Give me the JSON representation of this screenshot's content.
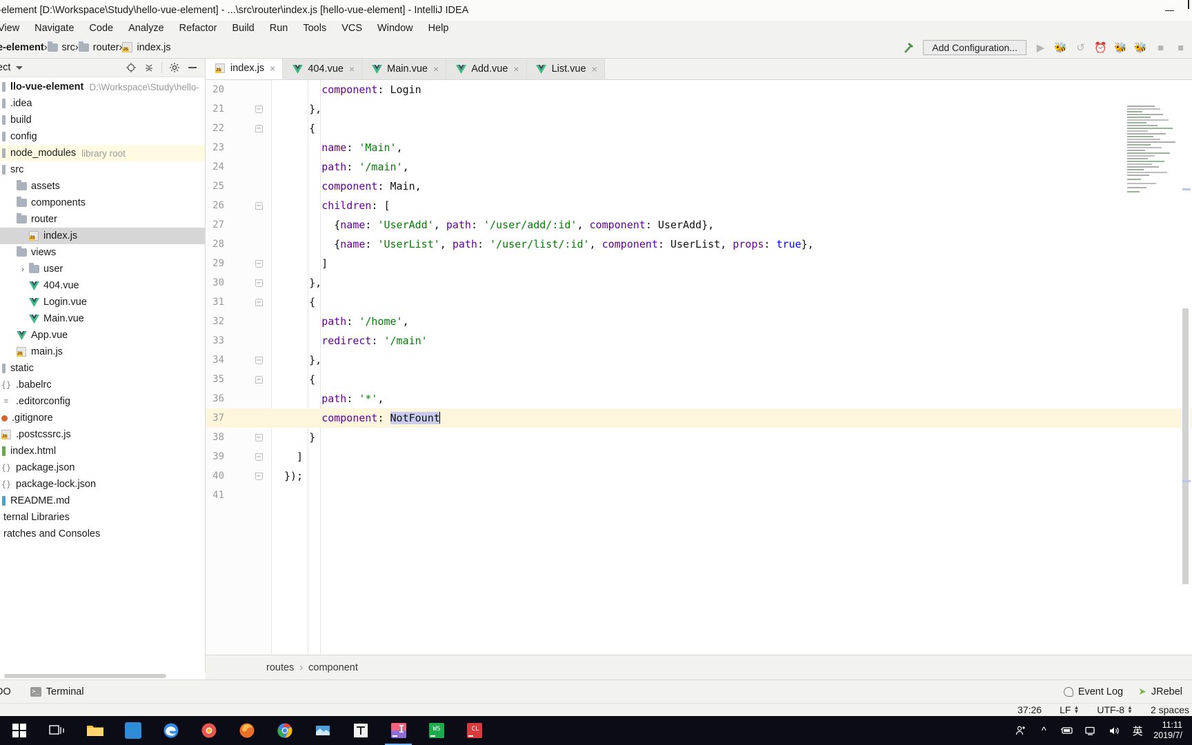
{
  "window": {
    "title": "-element [D:\\Workspace\\Study\\hello-vue-element] - ...\\src\\router\\index.js [hello-vue-element] - IntelliJ IDEA",
    "minimize_label": "minimize-icon"
  },
  "menubar": {
    "items": [
      {
        "label": "View"
      },
      {
        "label": "Navigate"
      },
      {
        "label": "Code"
      },
      {
        "label": "Analyze"
      },
      {
        "label": "Refactor"
      },
      {
        "label": "Build"
      },
      {
        "label": "Run"
      },
      {
        "label": "Tools"
      },
      {
        "label": "VCS"
      },
      {
        "label": "Window"
      },
      {
        "label": "Help"
      }
    ]
  },
  "navbar": {
    "breadcrumbs": [
      {
        "label": "e-element",
        "icon": "",
        "bold": true
      },
      {
        "label": "src",
        "icon": "folder-icon",
        "bold": false
      },
      {
        "label": "router",
        "icon": "folder-icon",
        "bold": false
      },
      {
        "label": "index.js",
        "icon": "js-file-icon",
        "bold": false
      }
    ],
    "separator": "›",
    "build_icon": "hammer-icon",
    "add_configuration_label": "Add Configuration...",
    "run_icons": [
      "run-icon",
      "debug-icon",
      "run-with-coverage-icon",
      "profile-icon",
      "attach-debugger-icon",
      "stop-icon",
      "more-run-icon"
    ]
  },
  "project_pane": {
    "header": {
      "title": "ect",
      "caret": "chevron-down-icon",
      "actions": [
        "locate-icon",
        "collapse-all-icon",
        "settings-gear-icon",
        "hide-icon"
      ]
    },
    "tree": [
      {
        "label": "llo-vue-element",
        "sub": "D:\\Workspace\\Study\\hello-",
        "indent": 0,
        "icon": "project-icon",
        "bold": true,
        "arrow": "",
        "state": ""
      },
      {
        "label": ".idea",
        "sub": "",
        "indent": 0,
        "icon": "module-icon",
        "bold": false,
        "arrow": "",
        "state": ""
      },
      {
        "label": "build",
        "sub": "",
        "indent": 0,
        "icon": "module-icon",
        "bold": false,
        "arrow": "",
        "state": ""
      },
      {
        "label": "config",
        "sub": "",
        "indent": 0,
        "icon": "module-icon",
        "bold": false,
        "arrow": "",
        "state": ""
      },
      {
        "label": "node_modules",
        "sub": "library root",
        "indent": 0,
        "icon": "module-icon",
        "bold": false,
        "arrow": "",
        "state": "library"
      },
      {
        "label": "src",
        "sub": "",
        "indent": 0,
        "icon": "module-icon",
        "bold": false,
        "arrow": "",
        "state": ""
      },
      {
        "label": "assets",
        "sub": "",
        "indent": 1,
        "icon": "folder-icon",
        "bold": false,
        "arrow": "",
        "state": ""
      },
      {
        "label": "components",
        "sub": "",
        "indent": 1,
        "icon": "folder-icon",
        "bold": false,
        "arrow": "",
        "state": ""
      },
      {
        "label": "router",
        "sub": "",
        "indent": 1,
        "icon": "folder-icon",
        "bold": false,
        "arrow": "",
        "state": ""
      },
      {
        "label": "index.js",
        "sub": "",
        "indent": 2,
        "icon": "js-file-icon",
        "bold": false,
        "arrow": "",
        "state": "selected"
      },
      {
        "label": "views",
        "sub": "",
        "indent": 1,
        "icon": "folder-icon",
        "bold": false,
        "arrow": "",
        "state": ""
      },
      {
        "label": "user",
        "sub": "",
        "indent": 2,
        "icon": "folder-icon",
        "bold": false,
        "arrow": "›",
        "state": ""
      },
      {
        "label": "404.vue",
        "sub": "",
        "indent": 2,
        "icon": "vue-file-icon",
        "bold": false,
        "arrow": "",
        "state": ""
      },
      {
        "label": "Login.vue",
        "sub": "",
        "indent": 2,
        "icon": "vue-file-icon",
        "bold": false,
        "arrow": "",
        "state": ""
      },
      {
        "label": "Main.vue",
        "sub": "",
        "indent": 2,
        "icon": "vue-file-icon",
        "bold": false,
        "arrow": "",
        "state": ""
      },
      {
        "label": "App.vue",
        "sub": "",
        "indent": 1,
        "icon": "vue-file-icon",
        "bold": false,
        "arrow": "",
        "state": ""
      },
      {
        "label": "main.js",
        "sub": "",
        "indent": 1,
        "icon": "js-file-icon",
        "bold": false,
        "arrow": "",
        "state": ""
      },
      {
        "label": "static",
        "sub": "",
        "indent": 0,
        "icon": "module-icon",
        "bold": false,
        "arrow": "",
        "state": ""
      },
      {
        "label": ".babelrc",
        "sub": "",
        "indent": 0,
        "icon": "json-file-icon",
        "bold": false,
        "arrow": "",
        "state": ""
      },
      {
        "label": ".editorconfig",
        "sub": "",
        "indent": 0,
        "icon": "config-file-icon",
        "bold": false,
        "arrow": "",
        "state": ""
      },
      {
        "label": ".gitignore",
        "sub": "",
        "indent": 0,
        "icon": "git-file-icon",
        "bold": false,
        "arrow": "",
        "state": ""
      },
      {
        "label": ".postcssrc.js",
        "sub": "",
        "indent": 0,
        "icon": "js-file-icon",
        "bold": false,
        "arrow": "",
        "state": ""
      },
      {
        "label": "index.html",
        "sub": "",
        "indent": 0,
        "icon": "html-file-icon",
        "bold": false,
        "arrow": "",
        "state": ""
      },
      {
        "label": "package.json",
        "sub": "",
        "indent": 0,
        "icon": "json-file-icon",
        "bold": false,
        "arrow": "",
        "state": ""
      },
      {
        "label": "package-lock.json",
        "sub": "",
        "indent": 0,
        "icon": "json-file-icon",
        "bold": false,
        "arrow": "",
        "state": ""
      },
      {
        "label": "README.md",
        "sub": "",
        "indent": 0,
        "icon": "markdown-file-icon",
        "bold": false,
        "arrow": "",
        "state": ""
      },
      {
        "label": "ternal Libraries",
        "sub": "",
        "indent": 0,
        "icon": "",
        "bold": false,
        "arrow": "",
        "state": ""
      },
      {
        "label": "ratches and Consoles",
        "sub": "",
        "indent": 0,
        "icon": "",
        "bold": false,
        "arrow": "",
        "state": ""
      }
    ]
  },
  "editor": {
    "tabs": [
      {
        "label": "index.js",
        "icon": "js-file-icon",
        "active": true
      },
      {
        "label": "404.vue",
        "icon": "vue-file-icon",
        "active": false
      },
      {
        "label": "Main.vue",
        "icon": "vue-file-icon",
        "active": false
      },
      {
        "label": "Add.vue",
        "icon": "vue-file-icon",
        "active": false
      },
      {
        "label": "List.vue",
        "icon": "vue-file-icon",
        "active": false
      }
    ],
    "tab_close_glyph": "×",
    "first_visible_line": 20,
    "current_line": 37,
    "lines": [
      {
        "n": 20,
        "fold": "",
        "tokens": [
          {
            "t": "      ",
            "c": "plain"
          },
          {
            "t": "component",
            "c": "kw"
          },
          {
            "t": ": Login",
            "c": "plain"
          }
        ]
      },
      {
        "n": 21,
        "fold": "bot",
        "tokens": [
          {
            "t": "    },",
            "c": "plain"
          }
        ]
      },
      {
        "n": 22,
        "fold": "top",
        "tokens": [
          {
            "t": "    {",
            "c": "plain"
          }
        ]
      },
      {
        "n": 23,
        "fold": "",
        "tokens": [
          {
            "t": "      ",
            "c": "plain"
          },
          {
            "t": "name",
            "c": "kw"
          },
          {
            "t": ": ",
            "c": "plain"
          },
          {
            "t": "'Main'",
            "c": "str"
          },
          {
            "t": ",",
            "c": "plain"
          }
        ]
      },
      {
        "n": 24,
        "fold": "",
        "tokens": [
          {
            "t": "      ",
            "c": "plain"
          },
          {
            "t": "path",
            "c": "kw"
          },
          {
            "t": ": ",
            "c": "plain"
          },
          {
            "t": "'/main'",
            "c": "str"
          },
          {
            "t": ",",
            "c": "plain"
          }
        ]
      },
      {
        "n": 25,
        "fold": "",
        "tokens": [
          {
            "t": "      ",
            "c": "plain"
          },
          {
            "t": "component",
            "c": "kw"
          },
          {
            "t": ": Main,",
            "c": "plain"
          }
        ]
      },
      {
        "n": 26,
        "fold": "top",
        "tokens": [
          {
            "t": "      ",
            "c": "plain"
          },
          {
            "t": "children",
            "c": "kw"
          },
          {
            "t": ": [",
            "c": "plain"
          }
        ]
      },
      {
        "n": 27,
        "fold": "",
        "tokens": [
          {
            "t": "        {",
            "c": "plain"
          },
          {
            "t": "name",
            "c": "kw"
          },
          {
            "t": ": ",
            "c": "plain"
          },
          {
            "t": "'UserAdd'",
            "c": "str"
          },
          {
            "t": ", ",
            "c": "plain"
          },
          {
            "t": "path",
            "c": "kw"
          },
          {
            "t": ": ",
            "c": "plain"
          },
          {
            "t": "'/user/add/:id'",
            "c": "str"
          },
          {
            "t": ", ",
            "c": "plain"
          },
          {
            "t": "component",
            "c": "kw"
          },
          {
            "t": ": UserAdd},",
            "c": "plain"
          }
        ]
      },
      {
        "n": 28,
        "fold": "",
        "tokens": [
          {
            "t": "        {",
            "c": "plain"
          },
          {
            "t": "name",
            "c": "kw"
          },
          {
            "t": ": ",
            "c": "plain"
          },
          {
            "t": "'UserList'",
            "c": "str"
          },
          {
            "t": ", ",
            "c": "plain"
          },
          {
            "t": "path",
            "c": "kw"
          },
          {
            "t": ": ",
            "c": "plain"
          },
          {
            "t": "'/user/list/:id'",
            "c": "str"
          },
          {
            "t": ", ",
            "c": "plain"
          },
          {
            "t": "component",
            "c": "kw"
          },
          {
            "t": ": UserList, ",
            "c": "plain"
          },
          {
            "t": "props",
            "c": "kw"
          },
          {
            "t": ": ",
            "c": "plain"
          },
          {
            "t": "true",
            "c": "num"
          },
          {
            "t": "},",
            "c": "plain"
          }
        ]
      },
      {
        "n": 29,
        "fold": "bot",
        "tokens": [
          {
            "t": "      ]",
            "c": "plain"
          }
        ]
      },
      {
        "n": 30,
        "fold": "bot",
        "tokens": [
          {
            "t": "    },",
            "c": "plain"
          }
        ]
      },
      {
        "n": 31,
        "fold": "top",
        "tokens": [
          {
            "t": "    {",
            "c": "plain"
          }
        ]
      },
      {
        "n": 32,
        "fold": "",
        "tokens": [
          {
            "t": "      ",
            "c": "plain"
          },
          {
            "t": "path",
            "c": "kw"
          },
          {
            "t": ": ",
            "c": "plain"
          },
          {
            "t": "'/home'",
            "c": "str"
          },
          {
            "t": ",",
            "c": "plain"
          }
        ]
      },
      {
        "n": 33,
        "fold": "",
        "tokens": [
          {
            "t": "      ",
            "c": "plain"
          },
          {
            "t": "redirect",
            "c": "kw"
          },
          {
            "t": ": ",
            "c": "plain"
          },
          {
            "t": "'/main'",
            "c": "str"
          }
        ]
      },
      {
        "n": 34,
        "fold": "bot",
        "tokens": [
          {
            "t": "    },",
            "c": "plain"
          }
        ]
      },
      {
        "n": 35,
        "fold": "top",
        "tokens": [
          {
            "t": "    {",
            "c": "plain"
          }
        ]
      },
      {
        "n": 36,
        "fold": "",
        "tokens": [
          {
            "t": "      ",
            "c": "plain"
          },
          {
            "t": "path",
            "c": "kw"
          },
          {
            "t": ": ",
            "c": "plain"
          },
          {
            "t": "'*'",
            "c": "str"
          },
          {
            "t": ",",
            "c": "plain"
          }
        ]
      },
      {
        "n": 37,
        "fold": "",
        "current": true,
        "tokens": [
          {
            "t": "      ",
            "c": "plain"
          },
          {
            "t": "component",
            "c": "kw"
          },
          {
            "t": ": ",
            "c": "plain"
          },
          {
            "t": "NotFount",
            "c": "sel"
          }
        ]
      },
      {
        "n": 38,
        "fold": "bot",
        "tokens": [
          {
            "t": "    }",
            "c": "plain"
          }
        ]
      },
      {
        "n": 39,
        "fold": "bot",
        "tokens": [
          {
            "t": "  ]",
            "c": "plain"
          }
        ]
      },
      {
        "n": 40,
        "fold": "bot",
        "tokens": [
          {
            "t": "});",
            "c": "plain"
          }
        ]
      },
      {
        "n": 41,
        "fold": "",
        "tokens": [
          {
            "t": "",
            "c": "plain"
          }
        ]
      }
    ],
    "breadcrumb": {
      "items": [
        "routes",
        "component"
      ],
      "separator": "›"
    }
  },
  "toolstrip": {
    "left_items": [
      {
        "label": "DO",
        "icon": "todo-icon"
      },
      {
        "label": "Terminal",
        "icon": "terminal-icon"
      }
    ],
    "right_items": [
      {
        "label": "Event Log",
        "icon": "event-log-icon"
      },
      {
        "label": "JRebel",
        "icon": "jrebel-icon"
      }
    ]
  },
  "statusbar": {
    "caret_position": "37:26",
    "line_separator": "LF",
    "encoding": "UTF-8",
    "indent": "2 spaces"
  },
  "taskbar": {
    "apps": [
      {
        "name": "start-button-icon",
        "color": "#ffffff"
      },
      {
        "name": "task-view-icon",
        "color": "#ffffff"
      },
      {
        "name": "explorer-icon",
        "color": "#f5c242"
      },
      {
        "name": "store-icon",
        "color": "#2e8bd8"
      },
      {
        "name": "edge-icon",
        "color": "#2f8de4"
      },
      {
        "name": "chrome-canary-icon",
        "color": "#e8554d"
      },
      {
        "name": "firefox-icon",
        "color": "#e8702a"
      },
      {
        "name": "chrome-icon",
        "color": "#4285f4"
      },
      {
        "name": "snipaste-icon",
        "color": "#4a9fd8"
      },
      {
        "name": "typora-icon",
        "color": "#f3f3f3"
      },
      {
        "name": "intellij-idea-icon",
        "color": "#8d6fd6"
      },
      {
        "name": "webstorm-icon",
        "color": "#1faa4f"
      },
      {
        "name": "clion-icon",
        "color": "#d73b3e"
      }
    ],
    "tray_icons": [
      "people-icon",
      "show-hidden-icon",
      "battery-icon",
      "network-icon",
      "volume-icon"
    ],
    "ime_label": "英",
    "clock_time": "11:11",
    "clock_date": "2019/7/"
  },
  "colors": {
    "accent_green": "#41b883",
    "keyword_purple": "#660099",
    "string_green": "#008000",
    "number_blue": "#0000ff",
    "selection_blue": "#c8cdf0",
    "current_line_yellow": "#fdf6dd",
    "taskbar_bg": "#0c0c17"
  }
}
